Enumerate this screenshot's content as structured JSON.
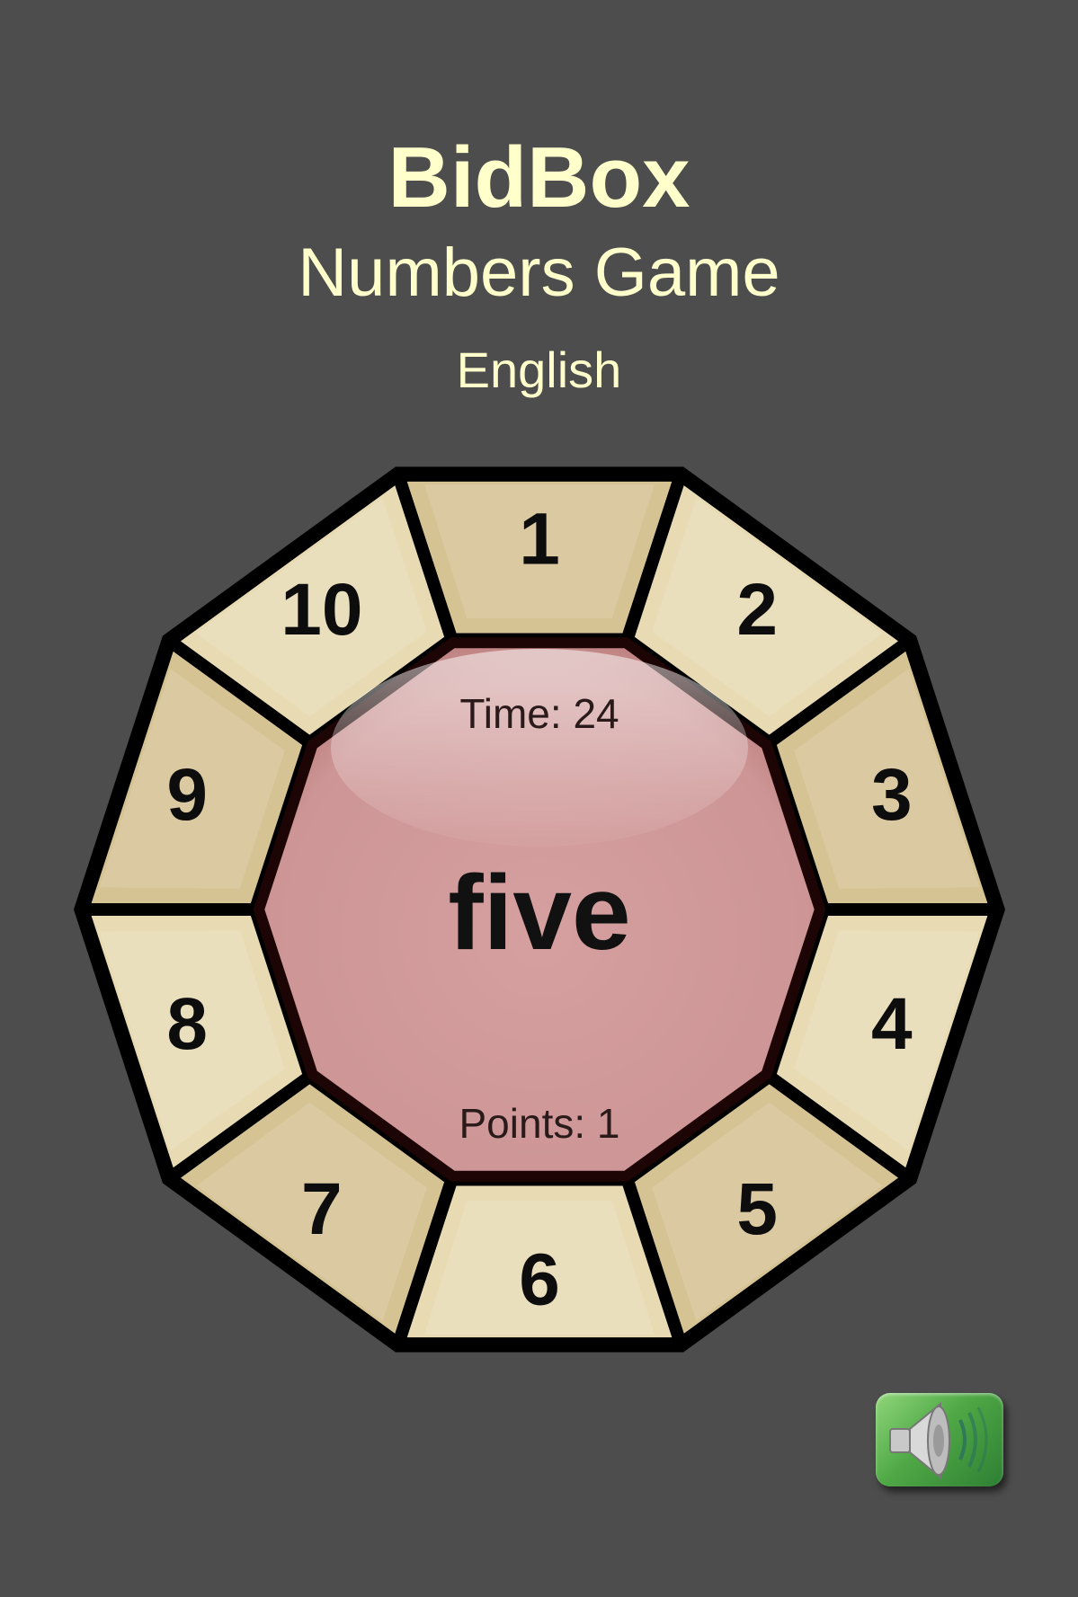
{
  "header": {
    "title": "BidBox",
    "subtitle": "Numbers Game",
    "language": "English"
  },
  "wheel": {
    "segments": [
      {
        "label": "1"
      },
      {
        "label": "2"
      },
      {
        "label": "3"
      },
      {
        "label": "4"
      },
      {
        "label": "5"
      },
      {
        "label": "6"
      },
      {
        "label": "7"
      },
      {
        "label": "8"
      },
      {
        "label": "9"
      },
      {
        "label": "10"
      }
    ],
    "center": {
      "time_text": "Time: 24",
      "word": "five",
      "points_text": "Points: 1"
    }
  },
  "colors": {
    "background": "#4d4d4d",
    "title_text": "#ffffcc",
    "segment_light": "#e8dbb4",
    "segment_dark": "#d6c394",
    "center_fill": "#d29a9a",
    "outline": "#000000"
  },
  "controls": {
    "sound_icon": "speaker-icon"
  }
}
